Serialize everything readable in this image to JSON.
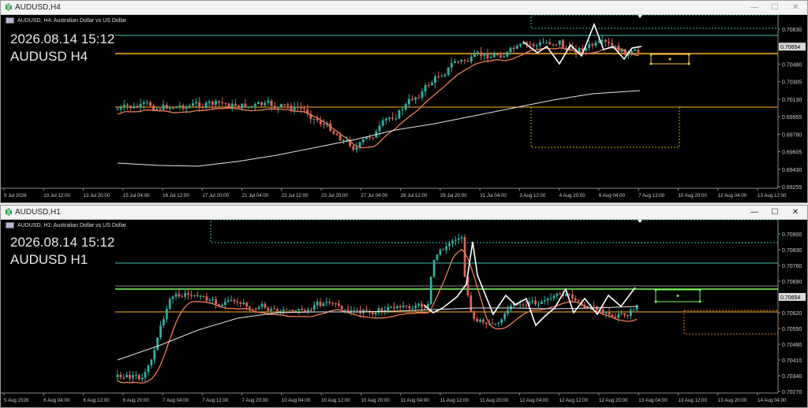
{
  "windows": [
    {
      "id": "h4",
      "window_title": "AUDUSD,H4",
      "header": "AUDUSD, H4:  Australian Dollar vs US Dollar",
      "date_overlay": "2026.08.14 15:12",
      "symbol_overlay": "AUDUSD H4",
      "current_price": "0.70654",
      "price_ticks": [
        "0.70830",
        "0.70654",
        "0.70480",
        "0.70305",
        "0.70130",
        "0.69955",
        "0.69780",
        "0.69605",
        "0.69430",
        "0.69255"
      ],
      "time_ticks": [
        "9 Jul 2026",
        "10 Jul 12:00",
        "13 Jul 20:00",
        "15 Jul 04:00",
        "16 Jul 12:00",
        "17 Jul 20:00",
        "21 Jul 04:00",
        "22 Jul 12:00",
        "23 Jul 20:00",
        "27 Jul 04:00",
        "28 Jul 12:00",
        "29 Jul 20:00",
        "31 Jul 04:00",
        "3 Aug 12:00",
        "4 Aug 20:00",
        "6 Aug 04:00",
        "7 Aug 12:00",
        "10 Aug 20:00",
        "12 Aug 04:00",
        "13 Aug 12:00"
      ]
    },
    {
      "id": "h1",
      "window_title": "AUDUSD,H1",
      "header": "AUDUSD, H1:  Australian Dollar vs US Dollar",
      "date_overlay": "2026.08.14 15:12",
      "symbol_overlay": "AUDUSD H1",
      "current_price": "0.70654",
      "price_ticks": [
        "0.70900",
        "0.70830",
        "0.70760",
        "0.70690",
        "0.70654",
        "0.70620",
        "0.70550",
        "0.70480",
        "0.70410",
        "0.70340",
        "0.70270"
      ],
      "time_ticks": [
        "5 Aug 2026",
        "6 Aug 04:00",
        "6 Aug 12:00",
        "6 Aug 20:00",
        "7 Aug 04:00",
        "7 Aug 12:00",
        "7 Aug 20:00",
        "10 Aug 04:00",
        "10 Aug 12:00",
        "10 Aug 20:00",
        "11 Aug 04:00",
        "11 Aug 12:00",
        "11 Aug 20:00",
        "12 Aug 04:00",
        "12 Aug 12:00",
        "12 Aug 20:00",
        "13 Aug 04:00",
        "13 Aug 12:00",
        "13 Aug 20:00",
        "14 Aug 04:00"
      ]
    }
  ],
  "window_buttons": {
    "minimize": "—",
    "maximize": "☐",
    "close": "✕"
  },
  "colors": {
    "background": "#000000",
    "bull_candle": "#2bb5a0",
    "bear_candle": "#e0625a",
    "ma_fast": "#f07a5a",
    "ma_slow": "#e6e6e6",
    "zigzag": "#ffffff",
    "level_orange": "#ffb020",
    "level_teal": "#3fbfb0",
    "level_green": "#7cfc5a"
  }
}
